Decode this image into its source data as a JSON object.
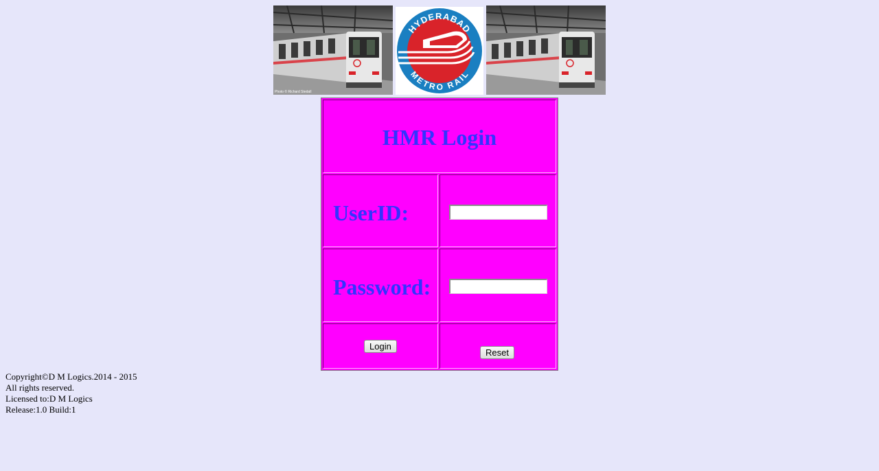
{
  "banner": {
    "logo_top_text": "HYDERABAD",
    "logo_bottom_text": "METRO RAIL",
    "photo_credit": "Photo © Richard Stedall"
  },
  "login": {
    "title": "HMR Login",
    "userid_label": "UserID:",
    "userid_value": "",
    "password_label": "Password:",
    "password_value": "",
    "login_button": "Login",
    "reset_button": "Reset"
  },
  "footer": {
    "copyright": "Copyright©D M Logics.2014 - 2015",
    "rights": "All rights reserved.",
    "license": "Licensed to:D M Logics",
    "release": "Release:1.0 Build:1"
  },
  "colors": {
    "page_background": "#e6e6fa",
    "table_background": "#ff00ff",
    "label_text": "#3333ff",
    "logo_blue": "#1a7fc1",
    "logo_red": "#d9232a"
  }
}
